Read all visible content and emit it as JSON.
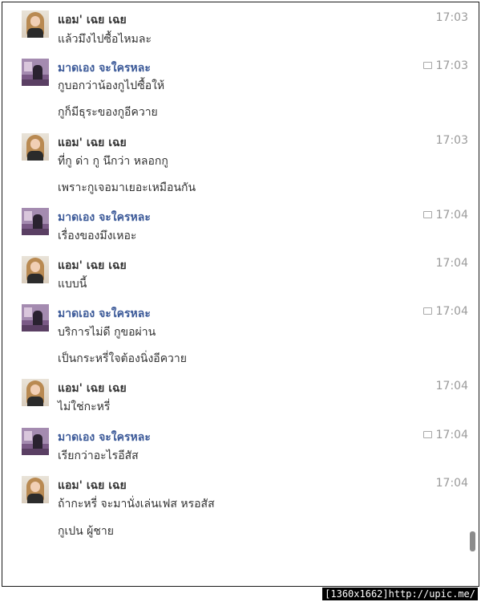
{
  "messages": [
    {
      "sender": "แอม' เฉย เฉย",
      "time": "17:03",
      "lines": [
        "แล้วมึงไปซื้อไหมละ"
      ]
    },
    {
      "sender": "มาดเอง จะใครหละ",
      "time": "17:03",
      "lines": [
        "กูบอกว่าน้องกูไปซื้อให้",
        "กูก็มีธุระของกูอีควาย"
      ]
    },
    {
      "sender": "แอม' เฉย เฉย",
      "time": "17:03",
      "lines": [
        "ที่กู ด่า กู นึกว่า หลอกกู",
        "เพราะกูเจอมาเยอะเหมือนกัน"
      ]
    },
    {
      "sender": "มาดเอง จะใครหละ",
      "time": "17:04",
      "lines": [
        "เรื่องของมึงเหอะ"
      ]
    },
    {
      "sender": "แอม' เฉย เฉย",
      "time": "17:04",
      "lines": [
        "แบบนี้"
      ]
    },
    {
      "sender": "มาดเอง จะใครหละ",
      "time": "17:04",
      "lines": [
        "บริการไม่ดี กูขอผ่าน",
        "เป็นกระหรี่ใจต้องนิ่งอีควาย"
      ]
    },
    {
      "sender": "แอม' เฉย เฉย",
      "time": "17:04",
      "lines": [
        "ไม่ใช่กะหรี่"
      ]
    },
    {
      "sender": "มาดเอง จะใครหละ",
      "time": "17:04",
      "lines": [
        "เรียกว่าอะไรอีสัส"
      ]
    },
    {
      "sender": "แอม' เฉย เฉย",
      "time": "17:04",
      "lines": [
        "ถ้ากะหรี่ จะมานั่งเล่นเฟส หรอสัส",
        "กูเปน ผู้ชาย"
      ]
    }
  ],
  "footer": "[1360x1662]http://upic.me/",
  "icons": {
    "seen": "chat-bubble-icon"
  },
  "colors": {
    "name_blue": "#3b5998",
    "text": "#333333",
    "time": "#9a9a9a"
  }
}
